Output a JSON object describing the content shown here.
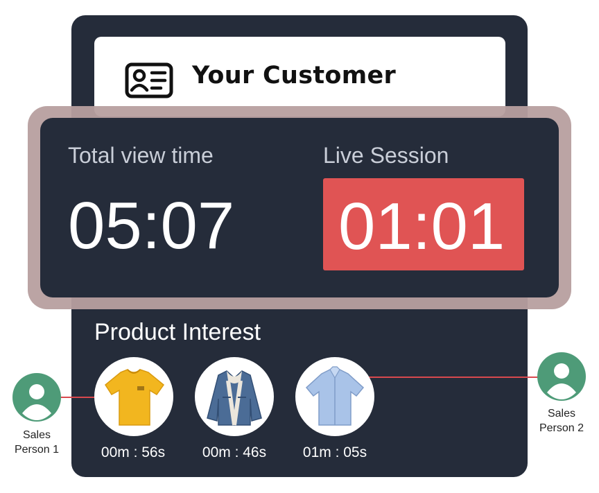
{
  "header": {
    "title": "Your Customer",
    "icon": "contact-card-icon"
  },
  "stats": {
    "total_view_time": {
      "label": "Total view time",
      "value": "05:07"
    },
    "live_session": {
      "label": "Live Session",
      "value": "01:01",
      "color": "#e05454"
    }
  },
  "product_interest": {
    "title": "Product Interest",
    "products": [
      {
        "icon": "yellow-tshirt-icon",
        "duration": "00m : 56s"
      },
      {
        "icon": "denim-jacket-icon",
        "duration": "00m : 46s"
      },
      {
        "icon": "blue-shirt-icon",
        "duration": "01m : 05s"
      }
    ]
  },
  "sales_people": [
    {
      "name_line1": "Sales",
      "name_line2": "Person 1",
      "icon": "user-avatar-icon"
    },
    {
      "name_line1": "Sales",
      "name_line2": "Person 2",
      "icon": "user-avatar-icon"
    }
  ],
  "colors": {
    "card": "#252c3a",
    "accent": "#e05454",
    "avatar": "#4e9b78",
    "connector": "#d9494e"
  }
}
